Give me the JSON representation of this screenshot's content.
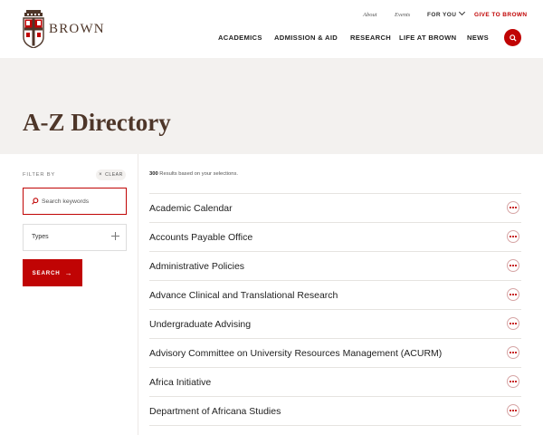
{
  "header": {
    "wordmark": "BROWN",
    "utility": {
      "about": "About",
      "events": "Events",
      "for_you": "FOR YOU",
      "give": "GIVE TO BROWN"
    },
    "nav": [
      "ACADEMICS",
      "ADMISSION & AID",
      "RESEARCH",
      "LIFE AT BROWN",
      "NEWS"
    ],
    "search_icon": "search-icon"
  },
  "hero": {
    "title": "A-Z Directory"
  },
  "sidebar": {
    "filter_label": "FILTER BY",
    "clear_label": "CLEAR",
    "search_placeholder": "Search keywords",
    "types_label": "Types",
    "search_button": "SEARCH",
    "search_button_arrow": "→"
  },
  "results": {
    "count": "300",
    "count_suffix": "Results based on your selections.",
    "items": [
      "Academic Calendar",
      "Accounts Payable Office",
      "Administrative Policies",
      "Advance Clinical and Translational Research",
      "Undergraduate Advising",
      "Advisory Committee on University Resources Management (ACURM)",
      "Africa Initiative",
      "Department of Africana Studies"
    ]
  },
  "colors": {
    "brand_red": "#c00404",
    "brand_brown": "#4e3629",
    "hero_bg": "#f3f1ef"
  }
}
